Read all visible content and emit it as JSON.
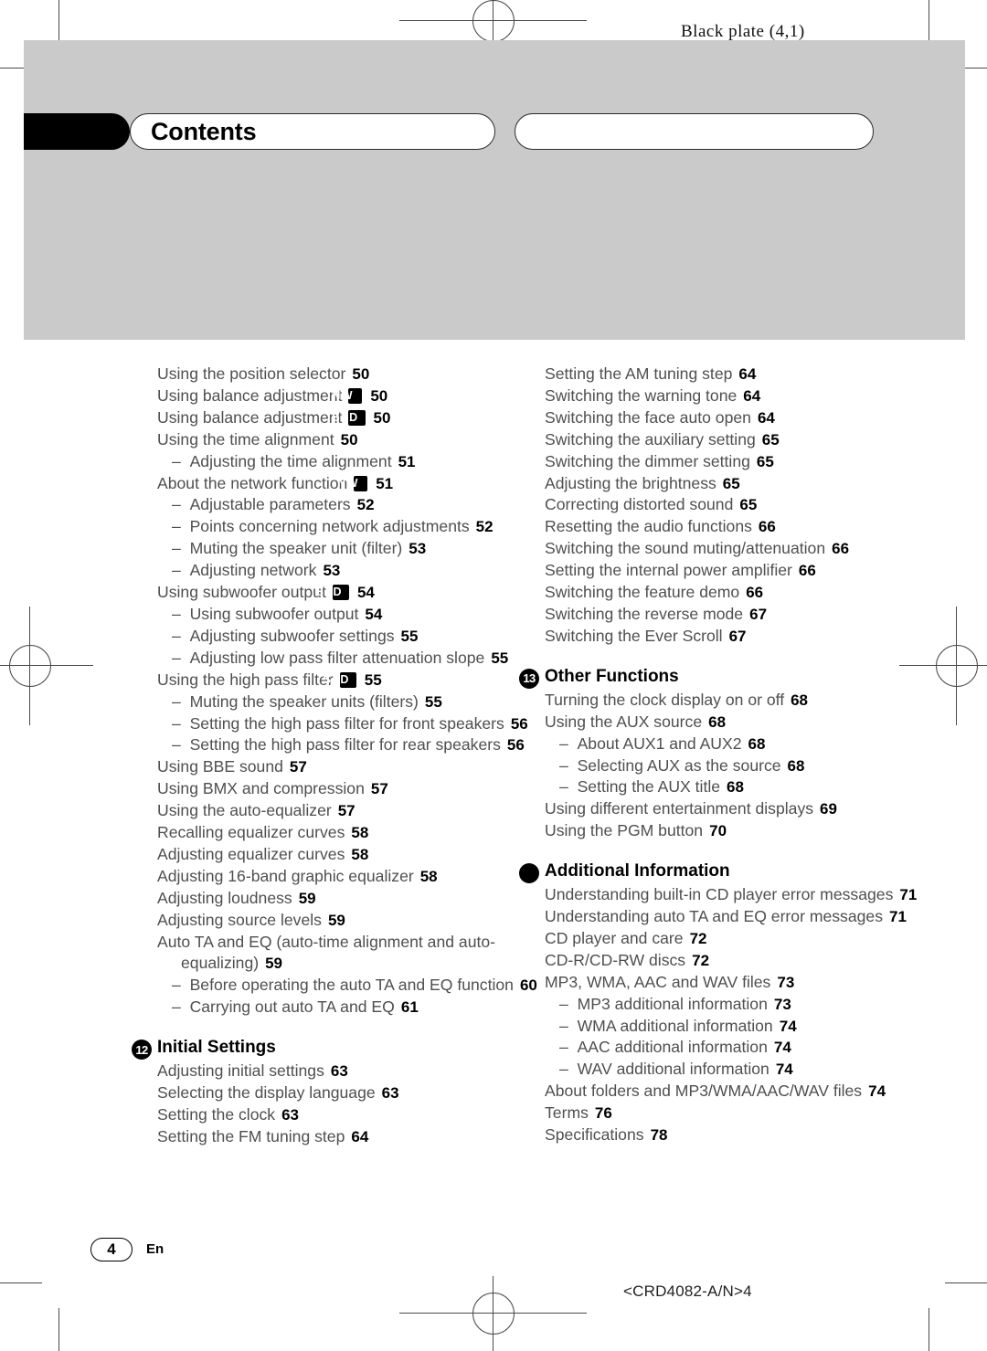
{
  "plate_note": "Black plate (4,1)",
  "header": {
    "title": "Contents",
    "right_tab_label": ""
  },
  "footer": {
    "page_number": "4",
    "language_code": "En",
    "doc_code": "<CRD4082-A/N>4"
  },
  "left_column": [
    {
      "level": "top",
      "text": "Using the position selector",
      "page": "50"
    },
    {
      "level": "top",
      "text": "Using balance adjustment",
      "badge": "NW",
      "page": "50"
    },
    {
      "level": "top",
      "text": "Using balance adjustment",
      "badge": "STD",
      "page": "50"
    },
    {
      "level": "top",
      "text": "Using the time alignment",
      "page": "50"
    },
    {
      "level": "sub",
      "text": "Adjusting the time alignment",
      "page": "51"
    },
    {
      "level": "top",
      "text": "About the network function",
      "badge": "NW",
      "page": "51"
    },
    {
      "level": "sub",
      "text": "Adjustable parameters",
      "page": "52"
    },
    {
      "level": "sub",
      "text": "Points concerning network adjustments",
      "page": "52"
    },
    {
      "level": "sub",
      "text": "Muting the speaker unit (filter)",
      "page": "53"
    },
    {
      "level": "sub",
      "text": "Adjusting network",
      "page": "53"
    },
    {
      "level": "top",
      "text": "Using subwoofer output",
      "badge": "STD",
      "page": "54"
    },
    {
      "level": "sub",
      "text": "Using subwoofer output",
      "page": "54"
    },
    {
      "level": "sub",
      "text": "Adjusting subwoofer settings",
      "page": "55"
    },
    {
      "level": "sub",
      "text": "Adjusting low pass filter attenuation slope",
      "page": "55"
    },
    {
      "level": "top",
      "text": "Using the high pass filter",
      "badge": "STD",
      "page": "55"
    },
    {
      "level": "sub",
      "text": "Muting the speaker units (filters)",
      "page": "55"
    },
    {
      "level": "sub",
      "text": "Setting the high pass filter for front speakers",
      "page": "56"
    },
    {
      "level": "sub",
      "text": "Setting the high pass filter for rear speakers",
      "page": "56"
    },
    {
      "level": "top",
      "text": "Using BBE sound",
      "page": "57"
    },
    {
      "level": "top",
      "text": "Using BMX and compression",
      "page": "57"
    },
    {
      "level": "top",
      "text": "Using the auto-equalizer",
      "page": "57"
    },
    {
      "level": "top",
      "text": "Recalling equalizer curves",
      "page": "58"
    },
    {
      "level": "top",
      "text": "Adjusting equalizer curves",
      "page": "58"
    },
    {
      "level": "top",
      "text": "Adjusting 16-band graphic equalizer",
      "page": "58"
    },
    {
      "level": "top",
      "text": "Adjusting loudness",
      "page": "59"
    },
    {
      "level": "top",
      "text": "Adjusting source levels",
      "page": "59"
    },
    {
      "level": "top",
      "text": "Auto TA and EQ (auto-time alignment and auto-equalizing)",
      "page": "59"
    },
    {
      "level": "sub",
      "text": "Before operating the auto TA and EQ function",
      "page": "60"
    },
    {
      "level": "sub",
      "text": "Carrying out auto TA and EQ",
      "page": "61"
    },
    {
      "level": "section",
      "number": "12",
      "text": "Initial Settings"
    },
    {
      "level": "top",
      "text": "Adjusting initial settings",
      "page": "63"
    },
    {
      "level": "top",
      "text": "Selecting the display language",
      "page": "63"
    },
    {
      "level": "top",
      "text": "Setting the clock",
      "page": "63"
    },
    {
      "level": "top",
      "text": "Setting the FM tuning step",
      "page": "64"
    }
  ],
  "right_column": [
    {
      "level": "top",
      "text": "Setting the AM tuning step",
      "page": "64"
    },
    {
      "level": "top",
      "text": "Switching the warning tone",
      "page": "64"
    },
    {
      "level": "top",
      "text": "Switching the face auto open",
      "page": "64"
    },
    {
      "level": "top",
      "text": "Switching the auxiliary setting",
      "page": "65"
    },
    {
      "level": "top",
      "text": "Switching the dimmer setting",
      "page": "65"
    },
    {
      "level": "top",
      "text": "Adjusting the brightness",
      "page": "65"
    },
    {
      "level": "top",
      "text": "Correcting distorted sound",
      "page": "65"
    },
    {
      "level": "top",
      "text": "Resetting the audio functions",
      "page": "66"
    },
    {
      "level": "top",
      "text": "Switching the sound muting/attenuation",
      "page": "66"
    },
    {
      "level": "top",
      "text": "Setting the internal power amplifier",
      "page": "66"
    },
    {
      "level": "top",
      "text": "Switching the feature demo",
      "page": "66"
    },
    {
      "level": "top",
      "text": "Switching the reverse mode",
      "page": "67"
    },
    {
      "level": "top",
      "text": "Switching the Ever Scroll",
      "page": "67"
    },
    {
      "level": "section",
      "number": "13",
      "text": "Other Functions"
    },
    {
      "level": "top",
      "text": "Turning the clock display on or off",
      "page": "68"
    },
    {
      "level": "top",
      "text": "Using the AUX source",
      "page": "68"
    },
    {
      "level": "sub",
      "text": "About AUX1 and AUX2",
      "page": "68"
    },
    {
      "level": "sub",
      "text": "Selecting AUX as the source",
      "page": "68"
    },
    {
      "level": "sub",
      "text": "Setting the AUX title",
      "page": "68"
    },
    {
      "level": "top",
      "text": "Using different entertainment displays",
      "page": "69"
    },
    {
      "level": "top",
      "text": "Using the PGM button",
      "page": "70"
    },
    {
      "level": "section",
      "number": "",
      "text": "Additional Information"
    },
    {
      "level": "top",
      "text": "Understanding built-in CD player error messages",
      "page": "71"
    },
    {
      "level": "top",
      "text": "Understanding auto TA and EQ error messages",
      "page": "71"
    },
    {
      "level": "top",
      "text": "CD player and care",
      "page": "72"
    },
    {
      "level": "top",
      "text": "CD-R/CD-RW discs",
      "page": "72"
    },
    {
      "level": "top",
      "text": "MP3, WMA, AAC and WAV files",
      "page": "73"
    },
    {
      "level": "sub",
      "text": "MP3 additional information",
      "page": "73"
    },
    {
      "level": "sub",
      "text": "WMA additional information",
      "page": "74"
    },
    {
      "level": "sub",
      "text": "AAC additional information",
      "page": "74"
    },
    {
      "level": "sub",
      "text": "WAV additional information",
      "page": "74"
    },
    {
      "level": "top",
      "text": "About folders and MP3/WMA/AAC/WAV files",
      "page": "74"
    },
    {
      "level": "top",
      "text": "Terms",
      "page": "76"
    },
    {
      "level": "top",
      "text": "Specifications",
      "page": "78"
    }
  ]
}
